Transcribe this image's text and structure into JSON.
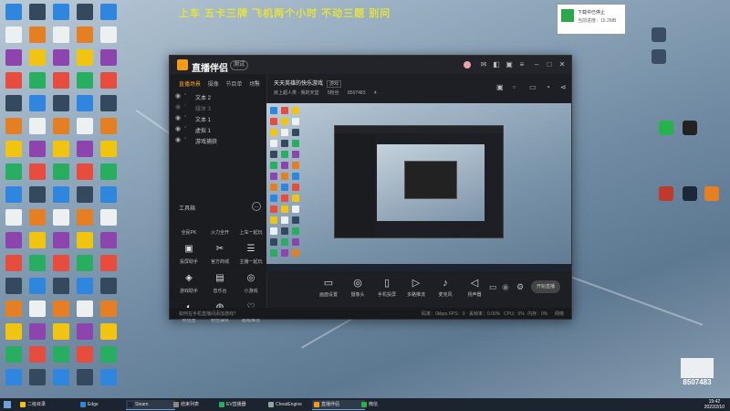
{
  "ticker_text": "上车 五卡三牌 飞机两个小时 不动三题 别问",
  "app": {
    "name": "直播伴侣",
    "version_badge": "测试",
    "scene_tabs": [
      "直播场景",
      "摄像",
      "节目单",
      "场景"
    ],
    "scenes": [
      "文本 2",
      "媒体 3",
      "文本 1",
      "虚拟 1",
      "游戏捕获"
    ],
    "tools_header": "工具箱",
    "tools": [
      "全民PK",
      "火力全开",
      "上车一起玩",
      "投屏助手",
      "官方商城",
      "主播一起玩",
      "游戏助手",
      "音乐台",
      "小游戏",
      "粉丝团",
      "粉丝抽奖",
      "超级推流"
    ],
    "room": {
      "title": "天天英雄的快乐游戏",
      "tag": "游戏",
      "meta": [
        "房上超人类 · 我的天堂",
        "5粉丝",
        "8507483",
        "4"
      ]
    },
    "bottom_tools": [
      "画面设置",
      "摄像头",
      "手机投屏",
      "多路推流",
      "麦克风",
      "扬声器"
    ],
    "start_button": "开始直播",
    "footer_hint": "如何在手机直播间添加游戏？",
    "footer_stats": [
      "码率：0kbps",
      "FPS：0",
      "丢帧率：0.00%",
      "CPU：0%",
      "内存：0%",
      "网络"
    ]
  },
  "popup": {
    "line1": "下载中已停止",
    "line2": "当前进度：15.2MB"
  },
  "taskbar": {
    "tasks": [
      "二级目录",
      "Edge",
      "Steam",
      "结束列表",
      "EV直播器",
      "CheatEngine",
      "直播伴侣",
      "微信"
    ],
    "time": "19:42",
    "date": "2022/2/10"
  },
  "watermark_number": "8507483",
  "colors": {
    "accent": "#f5a623",
    "ticker": "#e6e23a",
    "taskbar": "#1c2430",
    "app_bg": "#1e1f24"
  }
}
